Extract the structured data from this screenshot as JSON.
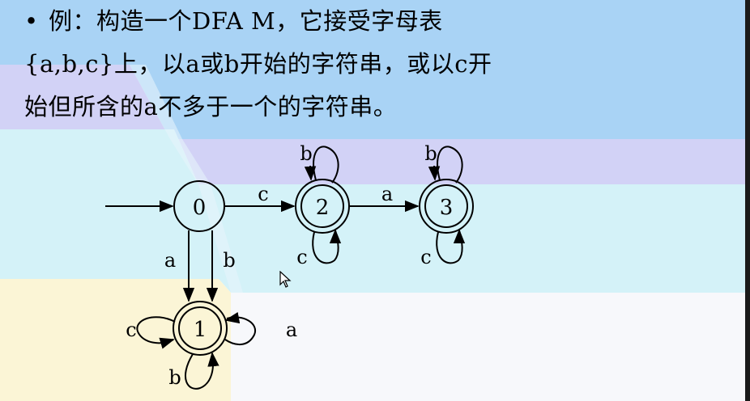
{
  "title_text": {
    "bullet": "•",
    "line1": "例：构造一个DFA M，它接受字母表",
    "line2": "{a,b,c}上，以a或b开始的字符串，或以c开",
    "line3": "始但所含的a不多于一个的字符串。"
  },
  "diagram": {
    "states": [
      {
        "id": "0",
        "label": "0",
        "accepting": false,
        "initial": true
      },
      {
        "id": "1",
        "label": "1",
        "accepting": true,
        "initial": false
      },
      {
        "id": "2",
        "label": "2",
        "accepting": true,
        "initial": false
      },
      {
        "id": "3",
        "label": "3",
        "accepting": true,
        "initial": false
      }
    ],
    "transitions": [
      {
        "from": "0",
        "to": "2",
        "label": "c"
      },
      {
        "from": "2",
        "to": "3",
        "label": "a"
      },
      {
        "from": "2",
        "to": "2",
        "label": "b"
      },
      {
        "from": "2",
        "to": "2",
        "label": "c"
      },
      {
        "from": "3",
        "to": "3",
        "label": "b"
      },
      {
        "from": "3",
        "to": "3",
        "label": "c"
      },
      {
        "from": "0",
        "to": "1",
        "label": "a"
      },
      {
        "from": "0",
        "to": "1",
        "label": "b"
      },
      {
        "from": "1",
        "to": "1",
        "label": "c"
      },
      {
        "from": "1",
        "to": "1",
        "label": "a"
      },
      {
        "from": "1",
        "to": "1",
        "label": "b"
      }
    ]
  },
  "colors": {
    "band_blue": "#a9d3f5",
    "band_lavender": "#d3d3f7",
    "band_cyan": "#d5f3f8",
    "band_yellow": "#fbf6d8",
    "ink": "#000000"
  }
}
